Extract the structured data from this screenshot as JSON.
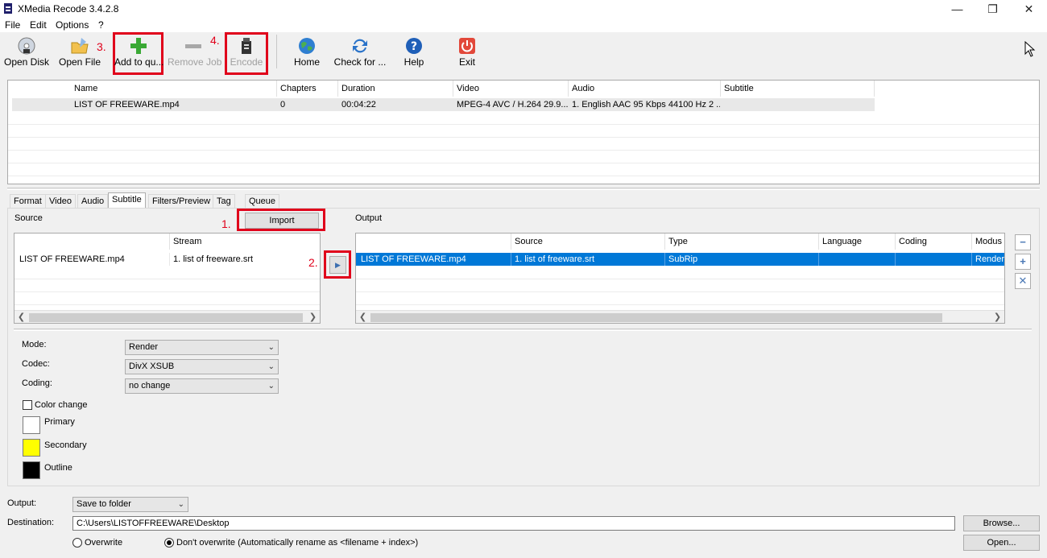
{
  "window": {
    "title": "XMedia Recode 3.4.2.8"
  },
  "menu": [
    "File",
    "Edit",
    "Options",
    "?"
  ],
  "toolbar": {
    "open_disk": "Open Disk",
    "open_file": "Open File",
    "add_to_queue": "Add to qu...",
    "remove_job": "Remove Job",
    "encode": "Encode",
    "home": "Home",
    "check_for_updates": "Check for ...",
    "help": "Help",
    "exit": "Exit"
  },
  "annotations": {
    "step1": "1.",
    "step2": "2.",
    "step3": "3.",
    "step4": "4."
  },
  "file_table": {
    "columns": [
      "Name",
      "Chapters",
      "Duration",
      "Video",
      "Audio",
      "Subtitle"
    ],
    "rows": [
      {
        "name": "LIST OF FREEWARE.mp4",
        "chapters": "0",
        "duration": "00:04:22",
        "video": "MPEG-4 AVC / H.264 29.9...",
        "audio": "1. English AAC  95 Kbps 44100 Hz 2 ...",
        "subtitle": ""
      }
    ]
  },
  "tabs": [
    "Format",
    "Video",
    "Audio",
    "Subtitle",
    "Filters/Preview",
    "Tag",
    "Queue"
  ],
  "active_tab": "Subtitle",
  "source": {
    "label": "Source",
    "import_button": "Import",
    "columns": [
      "",
      "Stream"
    ],
    "rows": [
      {
        "file": "LIST OF FREEWARE.mp4",
        "stream": "1. list of freeware.srt"
      }
    ]
  },
  "output": {
    "label": "Output",
    "columns": [
      "",
      "Source",
      "Type",
      "Language",
      "Coding",
      "Modus"
    ],
    "rows": [
      {
        "file": "LIST OF FREEWARE.mp4",
        "source": "1. list of freeware.srt",
        "type": "SubRip",
        "language": "",
        "coding": "",
        "modus": "Render"
      }
    ]
  },
  "settings": {
    "mode_label": "Mode:",
    "mode_value": "Render",
    "codec_label": "Codec:",
    "codec_value": "DivX XSUB",
    "coding_label": "Coding:",
    "coding_value": "no change",
    "color_change": "Color change",
    "primary": "Primary",
    "primary_color": "#ffffff",
    "secondary": "Secondary",
    "secondary_color": "#ffff00",
    "outline": "Outline",
    "outline_color": "#000000"
  },
  "bottom": {
    "output_label": "Output:",
    "output_value": "Save to folder",
    "destination_label": "Destination:",
    "destination_value": "C:\\Users\\LISTOFFREEWARE\\Desktop",
    "browse": "Browse...",
    "open": "Open...",
    "overwrite": "Overwrite",
    "dont_overwrite": "Don't overwrite (Automatically rename as <filename + index>)"
  },
  "colors": {
    "selection": "#0078d7",
    "accent_red": "#e0001b"
  }
}
